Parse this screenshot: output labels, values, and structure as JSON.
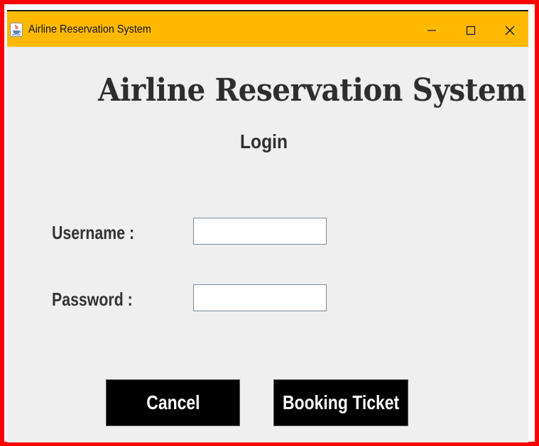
{
  "window": {
    "title": "Airline Reservation System",
    "icon": "java-cup-icon",
    "titlebar_color": "#ffb900",
    "controls": [
      "minimize-icon",
      "maximize-icon",
      "close-icon"
    ]
  },
  "form": {
    "heading": "Airline Reservation System",
    "subheading": "Login",
    "username_label": "Username :",
    "username_value": "",
    "password_label": "Password :",
    "password_value": ""
  },
  "buttons": {
    "cancel_label": "Cancel",
    "booking_label": "Booking Ticket",
    "background": "#000000",
    "text_color": "#ffffff"
  },
  "frame": {
    "border_color": "#ff0000"
  }
}
